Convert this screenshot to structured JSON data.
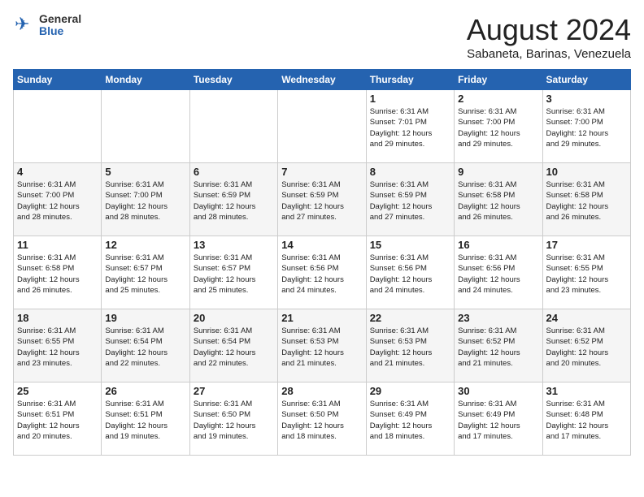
{
  "header": {
    "logo_general": "General",
    "logo_blue": "Blue",
    "month_year": "August 2024",
    "location": "Sabaneta, Barinas, Venezuela"
  },
  "weekdays": [
    "Sunday",
    "Monday",
    "Tuesday",
    "Wednesday",
    "Thursday",
    "Friday",
    "Saturday"
  ],
  "weeks": [
    [
      {
        "day": "",
        "info": ""
      },
      {
        "day": "",
        "info": ""
      },
      {
        "day": "",
        "info": ""
      },
      {
        "day": "",
        "info": ""
      },
      {
        "day": "1",
        "info": "Sunrise: 6:31 AM\nSunset: 7:01 PM\nDaylight: 12 hours\nand 29 minutes."
      },
      {
        "day": "2",
        "info": "Sunrise: 6:31 AM\nSunset: 7:00 PM\nDaylight: 12 hours\nand 29 minutes."
      },
      {
        "day": "3",
        "info": "Sunrise: 6:31 AM\nSunset: 7:00 PM\nDaylight: 12 hours\nand 29 minutes."
      }
    ],
    [
      {
        "day": "4",
        "info": "Sunrise: 6:31 AM\nSunset: 7:00 PM\nDaylight: 12 hours\nand 28 minutes."
      },
      {
        "day": "5",
        "info": "Sunrise: 6:31 AM\nSunset: 7:00 PM\nDaylight: 12 hours\nand 28 minutes."
      },
      {
        "day": "6",
        "info": "Sunrise: 6:31 AM\nSunset: 6:59 PM\nDaylight: 12 hours\nand 28 minutes."
      },
      {
        "day": "7",
        "info": "Sunrise: 6:31 AM\nSunset: 6:59 PM\nDaylight: 12 hours\nand 27 minutes."
      },
      {
        "day": "8",
        "info": "Sunrise: 6:31 AM\nSunset: 6:59 PM\nDaylight: 12 hours\nand 27 minutes."
      },
      {
        "day": "9",
        "info": "Sunrise: 6:31 AM\nSunset: 6:58 PM\nDaylight: 12 hours\nand 26 minutes."
      },
      {
        "day": "10",
        "info": "Sunrise: 6:31 AM\nSunset: 6:58 PM\nDaylight: 12 hours\nand 26 minutes."
      }
    ],
    [
      {
        "day": "11",
        "info": "Sunrise: 6:31 AM\nSunset: 6:58 PM\nDaylight: 12 hours\nand 26 minutes."
      },
      {
        "day": "12",
        "info": "Sunrise: 6:31 AM\nSunset: 6:57 PM\nDaylight: 12 hours\nand 25 minutes."
      },
      {
        "day": "13",
        "info": "Sunrise: 6:31 AM\nSunset: 6:57 PM\nDaylight: 12 hours\nand 25 minutes."
      },
      {
        "day": "14",
        "info": "Sunrise: 6:31 AM\nSunset: 6:56 PM\nDaylight: 12 hours\nand 24 minutes."
      },
      {
        "day": "15",
        "info": "Sunrise: 6:31 AM\nSunset: 6:56 PM\nDaylight: 12 hours\nand 24 minutes."
      },
      {
        "day": "16",
        "info": "Sunrise: 6:31 AM\nSunset: 6:56 PM\nDaylight: 12 hours\nand 24 minutes."
      },
      {
        "day": "17",
        "info": "Sunrise: 6:31 AM\nSunset: 6:55 PM\nDaylight: 12 hours\nand 23 minutes."
      }
    ],
    [
      {
        "day": "18",
        "info": "Sunrise: 6:31 AM\nSunset: 6:55 PM\nDaylight: 12 hours\nand 23 minutes."
      },
      {
        "day": "19",
        "info": "Sunrise: 6:31 AM\nSunset: 6:54 PM\nDaylight: 12 hours\nand 22 minutes."
      },
      {
        "day": "20",
        "info": "Sunrise: 6:31 AM\nSunset: 6:54 PM\nDaylight: 12 hours\nand 22 minutes."
      },
      {
        "day": "21",
        "info": "Sunrise: 6:31 AM\nSunset: 6:53 PM\nDaylight: 12 hours\nand 21 minutes."
      },
      {
        "day": "22",
        "info": "Sunrise: 6:31 AM\nSunset: 6:53 PM\nDaylight: 12 hours\nand 21 minutes."
      },
      {
        "day": "23",
        "info": "Sunrise: 6:31 AM\nSunset: 6:52 PM\nDaylight: 12 hours\nand 21 minutes."
      },
      {
        "day": "24",
        "info": "Sunrise: 6:31 AM\nSunset: 6:52 PM\nDaylight: 12 hours\nand 20 minutes."
      }
    ],
    [
      {
        "day": "25",
        "info": "Sunrise: 6:31 AM\nSunset: 6:51 PM\nDaylight: 12 hours\nand 20 minutes."
      },
      {
        "day": "26",
        "info": "Sunrise: 6:31 AM\nSunset: 6:51 PM\nDaylight: 12 hours\nand 19 minutes."
      },
      {
        "day": "27",
        "info": "Sunrise: 6:31 AM\nSunset: 6:50 PM\nDaylight: 12 hours\nand 19 minutes."
      },
      {
        "day": "28",
        "info": "Sunrise: 6:31 AM\nSunset: 6:50 PM\nDaylight: 12 hours\nand 18 minutes."
      },
      {
        "day": "29",
        "info": "Sunrise: 6:31 AM\nSunset: 6:49 PM\nDaylight: 12 hours\nand 18 minutes."
      },
      {
        "day": "30",
        "info": "Sunrise: 6:31 AM\nSunset: 6:49 PM\nDaylight: 12 hours\nand 17 minutes."
      },
      {
        "day": "31",
        "info": "Sunrise: 6:31 AM\nSunset: 6:48 PM\nDaylight: 12 hours\nand 17 minutes."
      }
    ]
  ]
}
